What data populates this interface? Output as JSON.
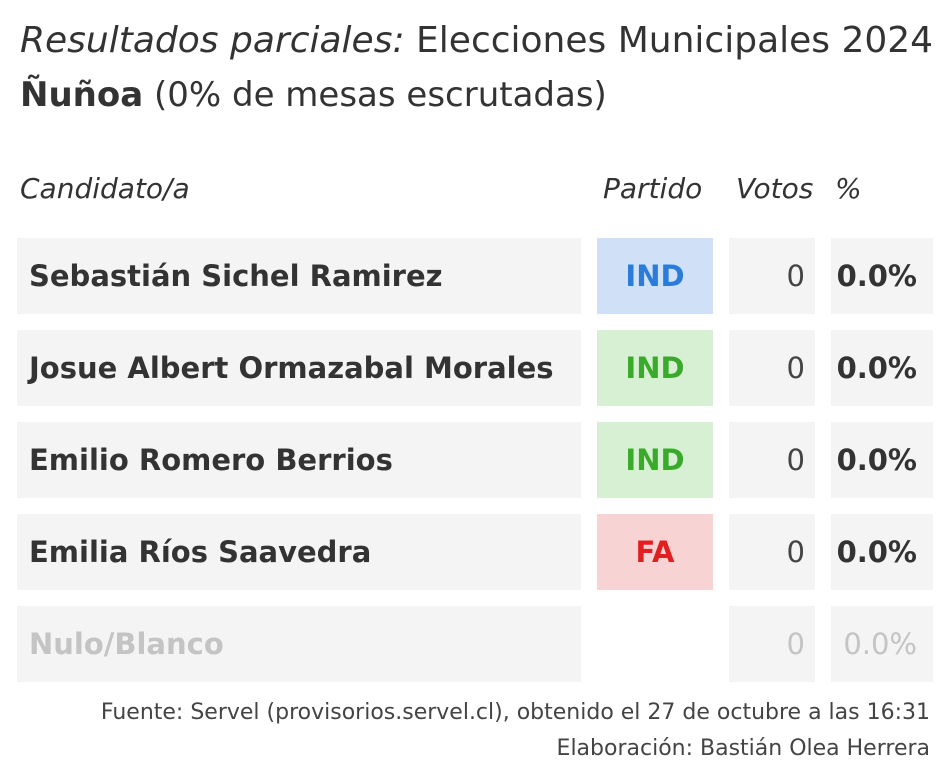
{
  "title": {
    "italic_part": "Resultados parciales:",
    "rest": "Elecciones Municipales 2024"
  },
  "subtitle": {
    "commune": "Ñuñoa",
    "progress": "(0% de mesas escrutadas)"
  },
  "table": {
    "headers": {
      "candidate": "Candidato/a",
      "party": "Partido",
      "votes": "Votos",
      "pct": "%"
    },
    "rows": [
      {
        "name": "Sebastián Sichel Ramirez",
        "party": "IND",
        "party_color": "#2b7bd9",
        "party_bg": "#cfe0f7",
        "votes": "0",
        "pct": "0.0%"
      },
      {
        "name": "Josue Albert Ormazabal Morales",
        "party": "IND",
        "party_color": "#3aaa2a",
        "party_bg": "#d7f0d3",
        "votes": "0",
        "pct": "0.0%"
      },
      {
        "name": "Emilio Romero Berrios",
        "party": "IND",
        "party_color": "#3aaa2a",
        "party_bg": "#d7f0d3",
        "votes": "0",
        "pct": "0.0%"
      },
      {
        "name": "Emilia Ríos Saavedra",
        "party": "FA",
        "party_color": "#e02020",
        "party_bg": "#f8d3d3",
        "votes": "0",
        "pct": "0.0%"
      },
      {
        "name": "Nulo/Blanco",
        "party": "",
        "party_color": "",
        "party_bg": "",
        "votes": "0",
        "pct": "0.0%"
      }
    ]
  },
  "footer": {
    "source": "Fuente: Servel (provisorios.servel.cl), obtenido el 27 de octubre a las 16:31",
    "credit": "Elaboración: Bastián Olea Herrera"
  },
  "colors": {
    "text": "#333333",
    "row_bg": "#f4f4f4",
    "muted": "#c4c4c4"
  }
}
